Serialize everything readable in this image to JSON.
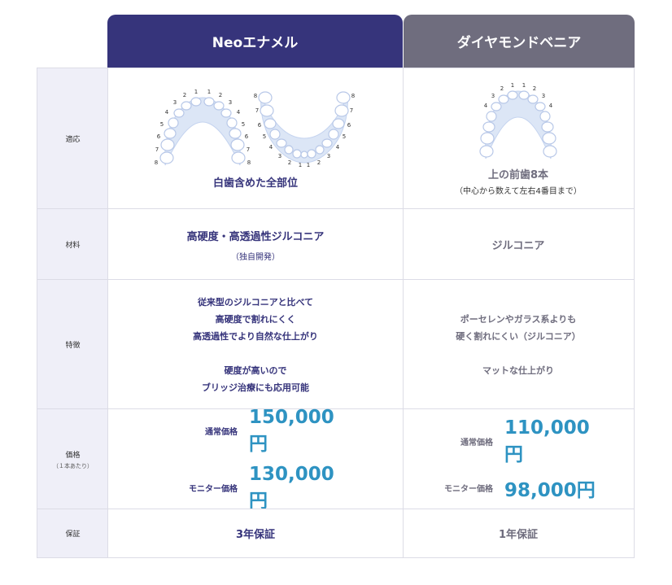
{
  "header": {
    "col1": "Neoエナメル",
    "col2": "ダイヤモンドベニア"
  },
  "rows": {
    "scope": {
      "label": "適応",
      "col1": "白歯含めた全部位",
      "col2_main": "上の前歯8本",
      "col2_sub": "（中心から数えて左右4番目まで）"
    },
    "material": {
      "label": "材料",
      "col1_main": "高硬度・高透過性ジルコニア",
      "col1_sub": "（独自開発）",
      "col2": "ジルコニア"
    },
    "features": {
      "label": "特徴",
      "col1_lines_a": [
        "従来型のジルコニアと比べて",
        "高硬度で割れにくく",
        "高透過性でより自然な仕上がり"
      ],
      "col1_lines_b": [
        "硬度が高いので",
        "ブリッジ治療にも応用可能"
      ],
      "col2_lines_a": [
        "ポーセレンやガラス系よりも",
        "硬く割れにくい（ジルコニア）"
      ],
      "col2_lines_b": [
        "マットな仕上がり"
      ]
    },
    "price": {
      "label": "価格",
      "label_sub": "（１本あたり）",
      "regular_label": "通常価格",
      "monitor_label": "モニター価格",
      "col1_regular": "150,000円",
      "col1_monitor": "130,000円",
      "col2_regular": "110,000円",
      "col2_monitor": "98,000円"
    },
    "warranty": {
      "label": "保証",
      "col1": "3年保証",
      "col2": "1年保証"
    }
  },
  "teeth_numbers": [
    "1",
    "2",
    "3",
    "4",
    "5",
    "6",
    "7",
    "8"
  ],
  "colors": {
    "neo": "#36347b",
    "diamond": "#6f6d7e",
    "price": "#2e93c2",
    "label_bg": "#efeff8"
  }
}
